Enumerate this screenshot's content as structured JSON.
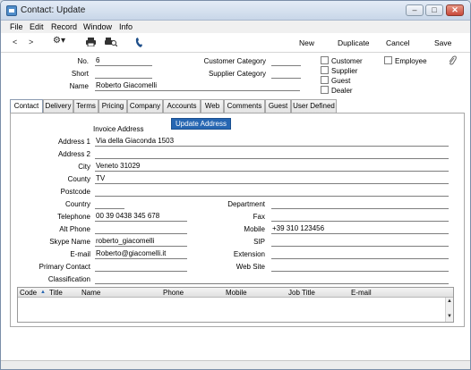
{
  "window": {
    "title": "Contact: Update",
    "minimize": "–",
    "maximize": "□",
    "close": "✕"
  },
  "menu": [
    "File",
    "Edit",
    "Record",
    "Window",
    "Info"
  ],
  "toolbar": {
    "prev": "<",
    "next": ">",
    "gear": "⚙▾",
    "actions": {
      "new": "New",
      "duplicate": "Duplicate",
      "cancel": "Cancel",
      "save": "Save"
    }
  },
  "header": {
    "no_label": "No.",
    "no_value": "6",
    "short_label": "Short",
    "short_value": "",
    "name_label": "Name",
    "name_value": "Roberto Giacomelli",
    "customer_category_label": "Customer Category",
    "customer_category_value": "",
    "supplier_category_label": "Supplier Category",
    "supplier_category_value": "",
    "checkboxes": {
      "customer": "Customer",
      "supplier": "Supplier",
      "guest": "Guest",
      "dealer": "Dealer",
      "employee": "Employee"
    }
  },
  "tabs": [
    "Contact",
    "Delivery",
    "Terms",
    "Pricing",
    "Company",
    "Accounts",
    "Web",
    "Comments",
    "Guest",
    "User Defined"
  ],
  "contact_tab": {
    "invoice_address_heading": "Invoice Address",
    "update_address_button": "Update Address",
    "address1_label": "Address 1",
    "address1_value": "Via della Giaconda 1503",
    "address2_label": "Address 2",
    "address2_value": "",
    "city_label": "City",
    "city_value": "Veneto 31029",
    "county_label": "County",
    "county_value": "TV",
    "postcode_label": "Postcode",
    "postcode_value": "",
    "country_label": "Country",
    "country_value": "",
    "telephone_label": "Telephone",
    "telephone_value": "00 39 0438 345 678",
    "alt_phone_label": "Alt Phone",
    "alt_phone_value": "",
    "skype_label": "Skype Name",
    "skype_value": "roberto_giacomelli",
    "email_label": "E-mail",
    "email_value": "Roberto@giacomelli.it",
    "primary_contact_label": "Primary Contact",
    "primary_contact_value": "",
    "classification_label": "Classification",
    "classification_value": "",
    "department_label": "Department",
    "department_value": "",
    "fax_label": "Fax",
    "fax_value": "",
    "mobile_label": "Mobile",
    "mobile_value": "+39 310 123456",
    "sip_label": "SIP",
    "sip_value": "",
    "extension_label": "Extension",
    "extension_value": "",
    "website_label": "Web Site",
    "website_value": ""
  },
  "grid": {
    "columns": [
      "Code",
      "Title",
      "Name",
      "Phone",
      "Mobile",
      "Job Title",
      "E-mail"
    ],
    "sort_indicator": "▲",
    "scroll_up": "▲",
    "scroll_down": "▼"
  }
}
